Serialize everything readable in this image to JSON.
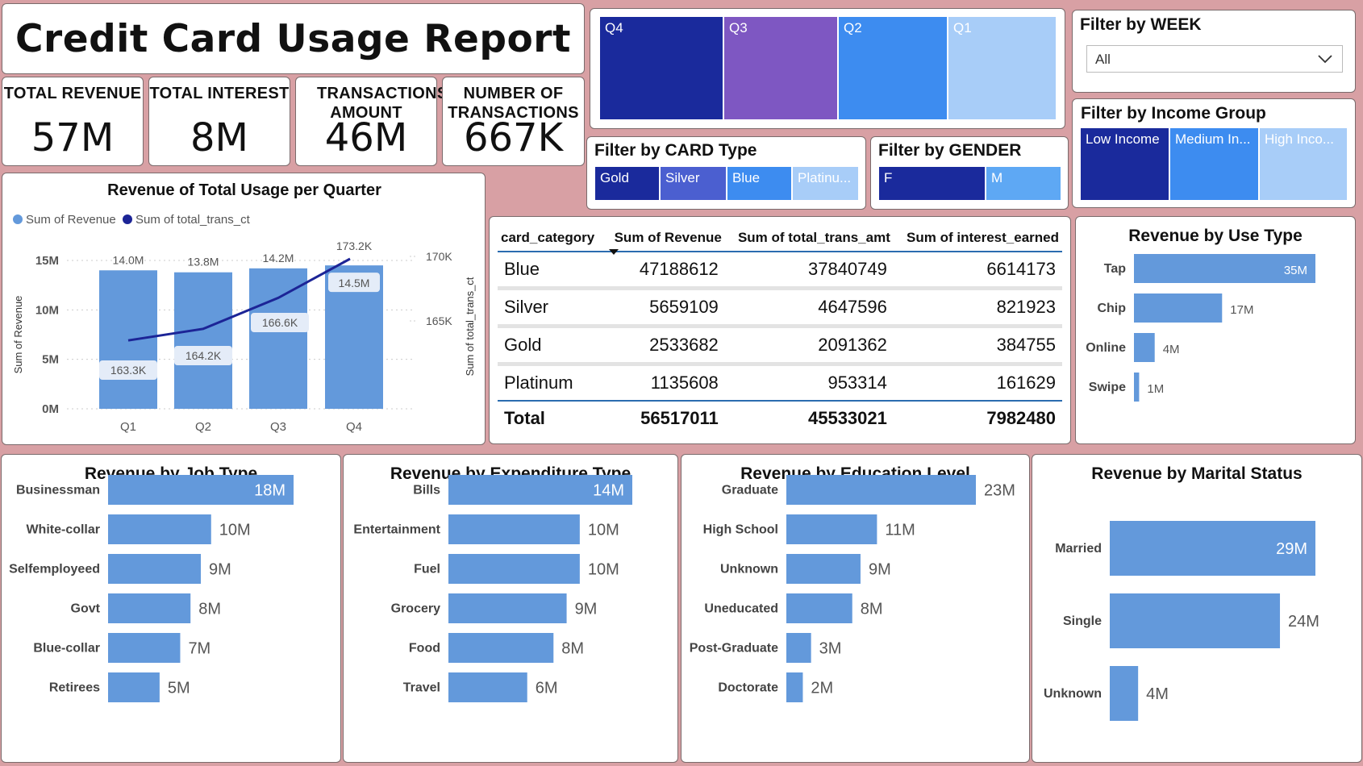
{
  "report_title": "Credit Card Usage Report",
  "kpis": [
    {
      "label": "TOTAL REVENUE",
      "value": "57M"
    },
    {
      "label": "TOTAL INTEREST",
      "value": "8M"
    },
    {
      "label": "TRANSACTIONS AMOUNT",
      "value": "46M"
    },
    {
      "label": "NUMBER OF TRANSACTIONS",
      "value": "667K"
    }
  ],
  "quarter_slicer": {
    "items": [
      "Q4",
      "Q3",
      "Q2",
      "Q1"
    ],
    "colors": [
      "#1a2a9c",
      "#7e57c2",
      "#3d8cf0",
      "#a8cdf8"
    ]
  },
  "week_filter": {
    "title": "Filter by WEEK",
    "selected": "All"
  },
  "income_filter": {
    "title": "Filter by Income Group",
    "items": [
      "Low Income",
      "Medium In...",
      "High Inco..."
    ],
    "colors": [
      "#1a2a9c",
      "#3d8cf0",
      "#a8cdf8"
    ]
  },
  "card_filter": {
    "title": "Filter by CARD Type",
    "items": [
      "Gold",
      "Silver",
      "Blue",
      "Platinu..."
    ],
    "colors": [
      "#1a2a9c",
      "#4b5fd0",
      "#3d8cf0",
      "#a8cdf8"
    ]
  },
  "gender_filter": {
    "title": "Filter by GENDER",
    "items": [
      "F",
      "M"
    ],
    "colors": [
      "#1a2a9c",
      "#5ea8f4"
    ]
  },
  "table": {
    "headers": [
      "card_category",
      "Sum of Revenue",
      "Sum of total_trans_amt",
      "Sum of interest_earned"
    ],
    "rows": [
      [
        "Blue",
        "47188612",
        "37840749",
        "6614173"
      ],
      [
        "Silver",
        "5659109",
        "4647596",
        "821923"
      ],
      [
        "Gold",
        "2533682",
        "2091362",
        "384755"
      ],
      [
        "Platinum",
        "1135608",
        "953314",
        "161629"
      ]
    ],
    "total": [
      "Total",
      "56517011",
      "45533021",
      "7982480"
    ]
  },
  "chart_data": [
    {
      "id": "quarter",
      "type": "bar",
      "title": "Revenue of Total Usage per Quarter",
      "categories": [
        "Q1",
        "Q2",
        "Q3",
        "Q4"
      ],
      "series": [
        {
          "name": "Sum of Revenue",
          "values": [
            14.0,
            13.8,
            14.2,
            14.5
          ],
          "labels": [
            "14.0M",
            "13.8M",
            "14.2M",
            "14.5M"
          ],
          "color": "#6399db"
        },
        {
          "name": "Sum of total_trans_ct",
          "values": [
            163.3,
            164.2,
            166.6,
            173.2
          ],
          "labels": [
            "163.3K",
            "164.2K",
            "166.6K",
            "173.2K"
          ],
          "color": "#1c2496"
        }
      ],
      "ylabel": "Sum of Revenue",
      "y2label": "Sum of total_trans_ct",
      "ylim": [
        0,
        15
      ],
      "yticks": [
        "0M",
        "5M",
        "10M",
        "15M"
      ],
      "y2ticks": [
        "165K",
        "170K"
      ],
      "legend": "top-left"
    },
    {
      "id": "use",
      "type": "bar",
      "title": "Revenue by Use Type",
      "categories": [
        "Tap",
        "Chip",
        "Online",
        "Swipe"
      ],
      "values": [
        35,
        17,
        4,
        1
      ],
      "labels": [
        "35M",
        "17M",
        "4M",
        "1M"
      ]
    },
    {
      "id": "job",
      "type": "bar",
      "title": "Revenue by Job Type",
      "categories": [
        "Businessman",
        "White-collar",
        "Selfemployeed",
        "Govt",
        "Blue-collar",
        "Retirees"
      ],
      "values": [
        18,
        10,
        9,
        8,
        7,
        5
      ],
      "labels": [
        "18M",
        "10M",
        "9M",
        "8M",
        "7M",
        "5M"
      ]
    },
    {
      "id": "exp",
      "type": "bar",
      "title": "Revenue by Expenditure Type",
      "categories": [
        "Bills",
        "Entertainment",
        "Fuel",
        "Grocery",
        "Food",
        "Travel"
      ],
      "values": [
        14,
        10,
        10,
        9,
        8,
        6
      ],
      "labels": [
        "14M",
        "10M",
        "10M",
        "9M",
        "8M",
        "6M"
      ]
    },
    {
      "id": "edu",
      "type": "bar",
      "title": "Revenue by Education Level",
      "categories": [
        "Graduate",
        "High School",
        "Unknown",
        "Uneducated",
        "Post-Graduate",
        "Doctorate"
      ],
      "values": [
        23,
        11,
        9,
        8,
        3,
        2
      ],
      "labels": [
        "23M",
        "11M",
        "9M",
        "8M",
        "3M",
        "2M"
      ]
    },
    {
      "id": "marital",
      "type": "bar",
      "title": "Revenue by Marital Status",
      "categories": [
        "Married",
        "Single",
        "Unknown"
      ],
      "values": [
        29,
        24,
        4
      ],
      "labels": [
        "29M",
        "24M",
        "4M"
      ]
    }
  ],
  "colors": {
    "bar": "#6399db",
    "line": "#1c2496",
    "panel_border": "#7a6b6c",
    "background": "#d8a0a4"
  }
}
